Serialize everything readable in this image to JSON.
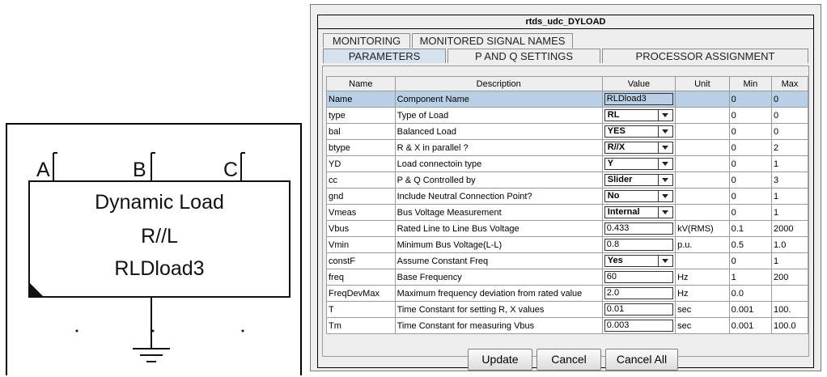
{
  "symbol": {
    "pins": [
      "A",
      "B",
      "C"
    ],
    "line1": "Dynamic Load",
    "line2": "R//L",
    "line3": "RLDload3"
  },
  "dialog": {
    "title": "rtds_udc_DYLOAD",
    "tabs_row1": [
      "MONITORING",
      "MONITORED SIGNAL NAMES"
    ],
    "tabs_row2": [
      "PARAMETERS",
      "P AND Q SETTINGS",
      "PROCESSOR ASSIGNMENT"
    ],
    "active_tab": "PARAMETERS",
    "columns": [
      "Name",
      "Description",
      "Value",
      "Unit",
      "Min",
      "Max"
    ],
    "rows": [
      {
        "name": "Name",
        "desc": "Component Name",
        "value": "RLDload3",
        "unit": "",
        "min": "0",
        "max": "0",
        "dropdown": false,
        "selected": true
      },
      {
        "name": "type",
        "desc": "Type of Load",
        "value": "RL",
        "unit": "",
        "min": "0",
        "max": "0",
        "dropdown": true
      },
      {
        "name": "bal",
        "desc": "Balanced Load",
        "value": "YES",
        "unit": "",
        "min": "0",
        "max": "0",
        "dropdown": true
      },
      {
        "name": "btype",
        "desc": "R & X in parallel ?",
        "value": "R//X",
        "unit": "",
        "min": "0",
        "max": "2",
        "dropdown": true
      },
      {
        "name": "YD",
        "desc": "Load connectoin type",
        "value": "Y",
        "unit": "",
        "min": "0",
        "max": "1",
        "dropdown": true
      },
      {
        "name": "cc",
        "desc": "P & Q Controlled by",
        "value": "Slider",
        "unit": "",
        "min": "0",
        "max": "3",
        "dropdown": true
      },
      {
        "name": "gnd",
        "desc": "Include Neutral Connection Point?",
        "value": "No",
        "unit": "",
        "min": "0",
        "max": "1",
        "dropdown": true
      },
      {
        "name": "Vmeas",
        "desc": "Bus Voltage Measurement",
        "value": "Internal",
        "unit": "",
        "min": "0",
        "max": "1",
        "dropdown": true
      },
      {
        "name": "Vbus",
        "desc": "Rated Line to Line Bus Voltage",
        "value": "0.433",
        "unit": "kV(RMS)",
        "min": "0.1",
        "max": "2000",
        "dropdown": false
      },
      {
        "name": "Vmin",
        "desc": "Minimum Bus Voltage(L-L)",
        "value": "0.8",
        "unit": "p.u.",
        "min": "0.5",
        "max": "1.0",
        "dropdown": false
      },
      {
        "name": "constF",
        "desc": "Assume Constant Freq",
        "value": "Yes",
        "unit": "",
        "min": "0",
        "max": "1",
        "dropdown": true
      },
      {
        "name": "freq",
        "desc": "Base Frequency",
        "value": "60",
        "unit": "Hz",
        "min": "1",
        "max": "200",
        "dropdown": false
      },
      {
        "name": "FreqDevMax",
        "desc": "Maximum frequency deviation from rated value",
        "value": "2.0",
        "unit": "Hz",
        "min": "0.0",
        "max": "",
        "dropdown": false
      },
      {
        "name": "T",
        "desc": "Time Constant for setting R, X values",
        "value": "0.01",
        "unit": "sec",
        "min": "0.001",
        "max": "100.",
        "dropdown": false
      },
      {
        "name": "Tm",
        "desc": "Time Constant for measuring Vbus",
        "value": "0.003",
        "unit": "sec",
        "min": "0.001",
        "max": "100.0",
        "dropdown": false
      }
    ],
    "buttons": {
      "update": "Update",
      "cancel": "Cancel",
      "cancel_all": "Cancel All"
    }
  }
}
